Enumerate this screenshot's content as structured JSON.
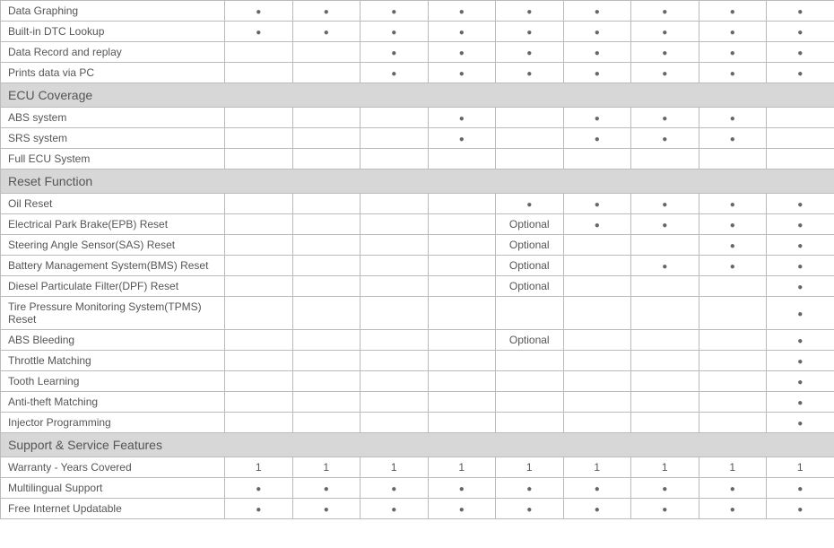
{
  "dot": "●",
  "columns": 9,
  "sections": [
    {
      "type": "rows",
      "rows": [
        {
          "label": "Data Graphing",
          "cells": [
            "●",
            "●",
            "●",
            "●",
            "●",
            "●",
            "●",
            "●",
            "●"
          ]
        },
        {
          "label": "Built-in DTC Lookup",
          "cells": [
            "●",
            "●",
            "●",
            "●",
            "●",
            "●",
            "●",
            "●",
            "●"
          ]
        },
        {
          "label": "Data Record and replay",
          "cells": [
            "",
            "",
            "●",
            "●",
            "●",
            "●",
            "●",
            "●",
            "●"
          ]
        },
        {
          "label": "Prints data via PC",
          "cells": [
            "",
            "",
            "●",
            "●",
            "●",
            "●",
            "●",
            "●",
            "●"
          ]
        }
      ]
    },
    {
      "type": "header",
      "title": "ECU Coverage"
    },
    {
      "type": "rows",
      "rows": [
        {
          "label": "ABS system",
          "cells": [
            "",
            "",
            "",
            "●",
            "",
            "●",
            "●",
            "●",
            ""
          ]
        },
        {
          "label": "SRS system",
          "cells": [
            "",
            "",
            "",
            "●",
            "",
            "●",
            "●",
            "●",
            ""
          ]
        },
        {
          "label": "Full ECU System",
          "cells": [
            "",
            "",
            "",
            "",
            "",
            "",
            "",
            "",
            ""
          ]
        }
      ]
    },
    {
      "type": "header",
      "title": "Reset Function"
    },
    {
      "type": "rows",
      "rows": [
        {
          "label": "Oil Reset",
          "cells": [
            "",
            "",
            "",
            "",
            "●",
            "●",
            "●",
            "●",
            "●"
          ]
        },
        {
          "label": "Electrical Park Brake(EPB) Reset",
          "cells": [
            "",
            "",
            "",
            "",
            "Optional",
            "●",
            "●",
            "●",
            "●"
          ]
        },
        {
          "label": "Steering Angle Sensor(SAS) Reset",
          "cells": [
            "",
            "",
            "",
            "",
            "Optional",
            "",
            "",
            "●",
            "●"
          ]
        },
        {
          "label": "Battery Management System(BMS) Reset",
          "cells": [
            "",
            "",
            "",
            "",
            "Optional",
            "",
            "●",
            "●",
            "●"
          ]
        },
        {
          "label": "Diesel Particulate Filter(DPF) Reset",
          "cells": [
            "",
            "",
            "",
            "",
            "Optional",
            "",
            "",
            "",
            "●"
          ]
        },
        {
          "label": "Tire Pressure Monitoring System(TPMS) Reset",
          "cells": [
            "",
            "",
            "",
            "",
            "",
            "",
            "",
            "",
            "●"
          ]
        },
        {
          "label": "ABS Bleeding",
          "cells": [
            "",
            "",
            "",
            "",
            "Optional",
            "",
            "",
            "",
            "●"
          ]
        },
        {
          "label": "Throttle Matching",
          "cells": [
            "",
            "",
            "",
            "",
            "",
            "",
            "",
            "",
            "●"
          ]
        },
        {
          "label": "Tooth Learning",
          "cells": [
            "",
            "",
            "",
            "",
            "",
            "",
            "",
            "",
            "●"
          ]
        },
        {
          "label": "Anti-theft Matching",
          "cells": [
            "",
            "",
            "",
            "",
            "",
            "",
            "",
            "",
            "●"
          ]
        },
        {
          "label": "Injector Programming",
          "cells": [
            "",
            "",
            "",
            "",
            "",
            "",
            "",
            "",
            "●"
          ]
        }
      ]
    },
    {
      "type": "header",
      "title": "Support & Service Features"
    },
    {
      "type": "rows",
      "rows": [
        {
          "label": "Warranty - Years Covered",
          "cells": [
            "1",
            "1",
            "1",
            "1",
            "1",
            "1",
            "1",
            "1",
            "1"
          ]
        },
        {
          "label": "Multilingual Support",
          "cells": [
            "●",
            "●",
            "●",
            "●",
            "●",
            "●",
            "●",
            "●",
            "●"
          ]
        },
        {
          "label": "Free Internet Updatable",
          "cells": [
            "●",
            "●",
            "●",
            "●",
            "●",
            "●",
            "●",
            "●",
            "●"
          ]
        }
      ]
    }
  ]
}
